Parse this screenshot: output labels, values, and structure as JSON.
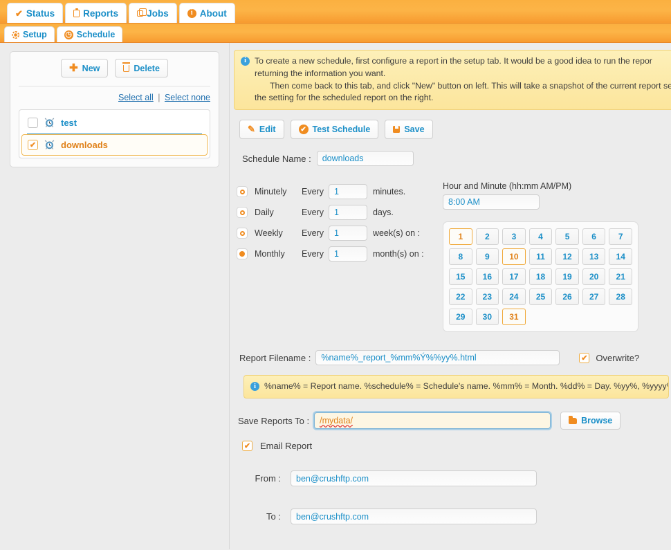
{
  "primary_tabs": [
    {
      "label": "Status",
      "icon": "check-icon",
      "active": false
    },
    {
      "label": "Reports",
      "icon": "clipboard-icon",
      "active": true
    },
    {
      "label": "Jobs",
      "icon": "jobs-icon",
      "active": false
    },
    {
      "label": "About",
      "icon": "info-icon",
      "active": false
    }
  ],
  "secondary_tabs": [
    {
      "label": "Setup",
      "icon": "gear-icon",
      "active": false
    },
    {
      "label": "Schedule",
      "icon": "clock-icon",
      "active": true
    }
  ],
  "sidebar": {
    "new_label": "New",
    "delete_label": "Delete",
    "select_all_label": "Select all",
    "select_separator": "|",
    "select_none_label": "Select none",
    "schedules": [
      {
        "name": "test",
        "checked": false,
        "selected": false
      },
      {
        "name": "downloads",
        "checked": true,
        "selected": true
      }
    ]
  },
  "info_banner": {
    "line1": "To create a new schedule, first configure a report in the setup tab. It would be a good idea to run the repor",
    "line2": "returning the information you want.",
    "line3": "Then come back to this tab, and click \"New\" button on left. This will take a snapshot of the current report se",
    "line4": "the setting for the scheduled report on the right."
  },
  "toolbar": {
    "edit_label": "Edit",
    "test_schedule_label": "Test Schedule",
    "save_label": "Save"
  },
  "schedule_name": {
    "label": "Schedule Name :",
    "value": "downloads"
  },
  "frequency": {
    "every_label": "Every",
    "options": [
      {
        "name": "Minutely",
        "value": "1",
        "unit": "minutes.",
        "selected": false
      },
      {
        "name": "Daily",
        "value": "1",
        "unit": "days.",
        "selected": false
      },
      {
        "name": "Weekly",
        "value": "1",
        "unit": "week(s) on :",
        "selected": false
      },
      {
        "name": "Monthly",
        "value": "1",
        "unit": "month(s) on :",
        "selected": true
      }
    ]
  },
  "hour_minute": {
    "label": "Hour and Minute (hh:mm AM/PM)",
    "value": "8:00 AM"
  },
  "day_grid": {
    "days": [
      "1",
      "2",
      "3",
      "4",
      "5",
      "6",
      "7",
      "8",
      "9",
      "10",
      "11",
      "12",
      "13",
      "14",
      "15",
      "16",
      "17",
      "18",
      "19",
      "20",
      "21",
      "22",
      "23",
      "24",
      "25",
      "26",
      "27",
      "28",
      "29",
      "30",
      "31"
    ],
    "selected": [
      "1",
      "10",
      "31"
    ]
  },
  "report_filename": {
    "label": "Report Filename :",
    "value": "%name%_report_%mm%Ý%%yy%.html",
    "overwrite_label": "Overwrite?",
    "overwrite_checked": true
  },
  "token_banner": {
    "text": "%name% = Report name. %schedule% = Schedule's name. %mm% = Month. %dd% = Day. %yy%, %yyyy% = Year."
  },
  "save_reports_to": {
    "label": "Save Reports To :",
    "value": "/mydata/",
    "browse_label": "Browse"
  },
  "email": {
    "report_label": "Email Report",
    "report_checked": true,
    "from_label": "From :",
    "from_value": "ben@crushftp.com",
    "to_label": "To :",
    "to_value": "ben@crushftp.com"
  },
  "colors": {
    "accent_orange": "#f08c20",
    "link_blue": "#1b8fc8",
    "banner_yellow": "#fce59c",
    "tab_bar": "#fbb040"
  }
}
